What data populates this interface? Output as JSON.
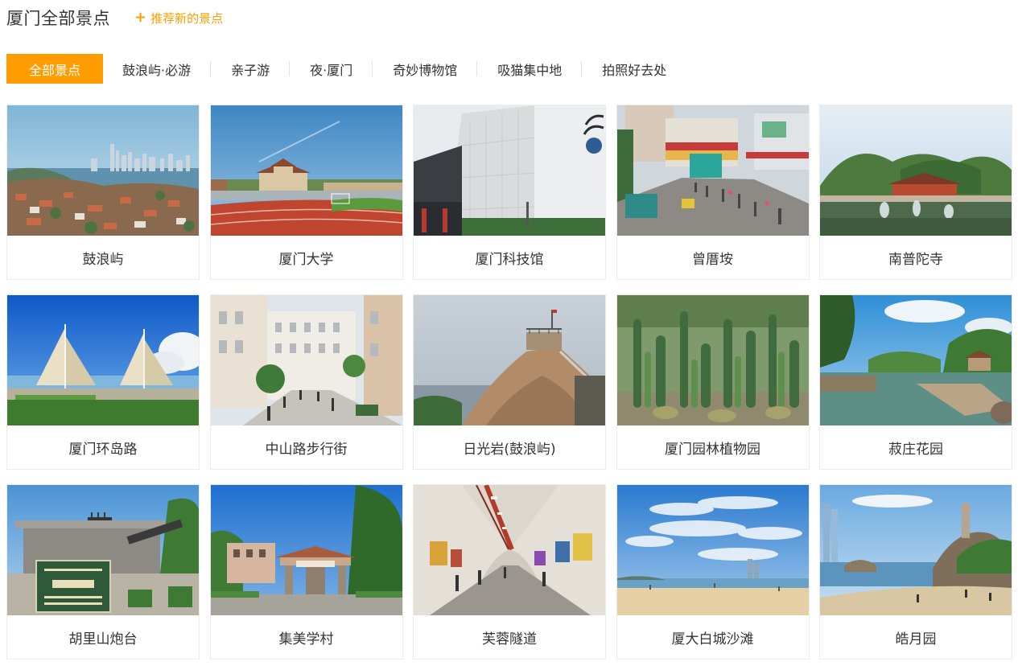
{
  "header": {
    "title": "厦门全部景点",
    "recommend_label": "推荐新的景点",
    "accent_color": "#ff9d00"
  },
  "tabs": [
    {
      "label": "全部景点",
      "active": true
    },
    {
      "label": "鼓浪屿·必游",
      "active": false
    },
    {
      "label": "亲子游",
      "active": false
    },
    {
      "label": "夜·厦门",
      "active": false
    },
    {
      "label": "奇妙博物馆",
      "active": false
    },
    {
      "label": "吸猫集中地",
      "active": false
    },
    {
      "label": "拍照好去处",
      "active": false
    }
  ],
  "attractions": [
    {
      "name": "鼓浪屿",
      "photo": "coastal-city-skyline-photo"
    },
    {
      "name": "厦门大学",
      "photo": "university-campus-track-photo"
    },
    {
      "name": "厦门科技馆",
      "photo": "science-museum-building-photo"
    },
    {
      "name": "曾厝垵",
      "photo": "village-street-market-photo"
    },
    {
      "name": "南普陀寺",
      "photo": "temple-pond-fountain-photo"
    },
    {
      "name": "厦门环岛路",
      "photo": "sail-sculpture-seaside-photo"
    },
    {
      "name": "中山路步行街",
      "photo": "pedestrian-street-photo"
    },
    {
      "name": "日光岩(鼓浪屿)",
      "photo": "rock-summit-lookout-photo"
    },
    {
      "name": "厦门园林植物园",
      "photo": "cactus-garden-photo"
    },
    {
      "name": "菽庄花园",
      "photo": "garden-pond-pavilion-photo"
    },
    {
      "name": "胡里山炮台",
      "photo": "fortress-cannon-photo"
    },
    {
      "name": "集美学村",
      "photo": "village-gate-archway-photo"
    },
    {
      "name": "芙蓉隧道",
      "photo": "graffiti-tunnel-photo"
    },
    {
      "name": "厦大白城沙滩",
      "photo": "beach-sky-towers-photo"
    },
    {
      "name": "皓月园",
      "photo": "bay-statue-beach-photo"
    }
  ]
}
